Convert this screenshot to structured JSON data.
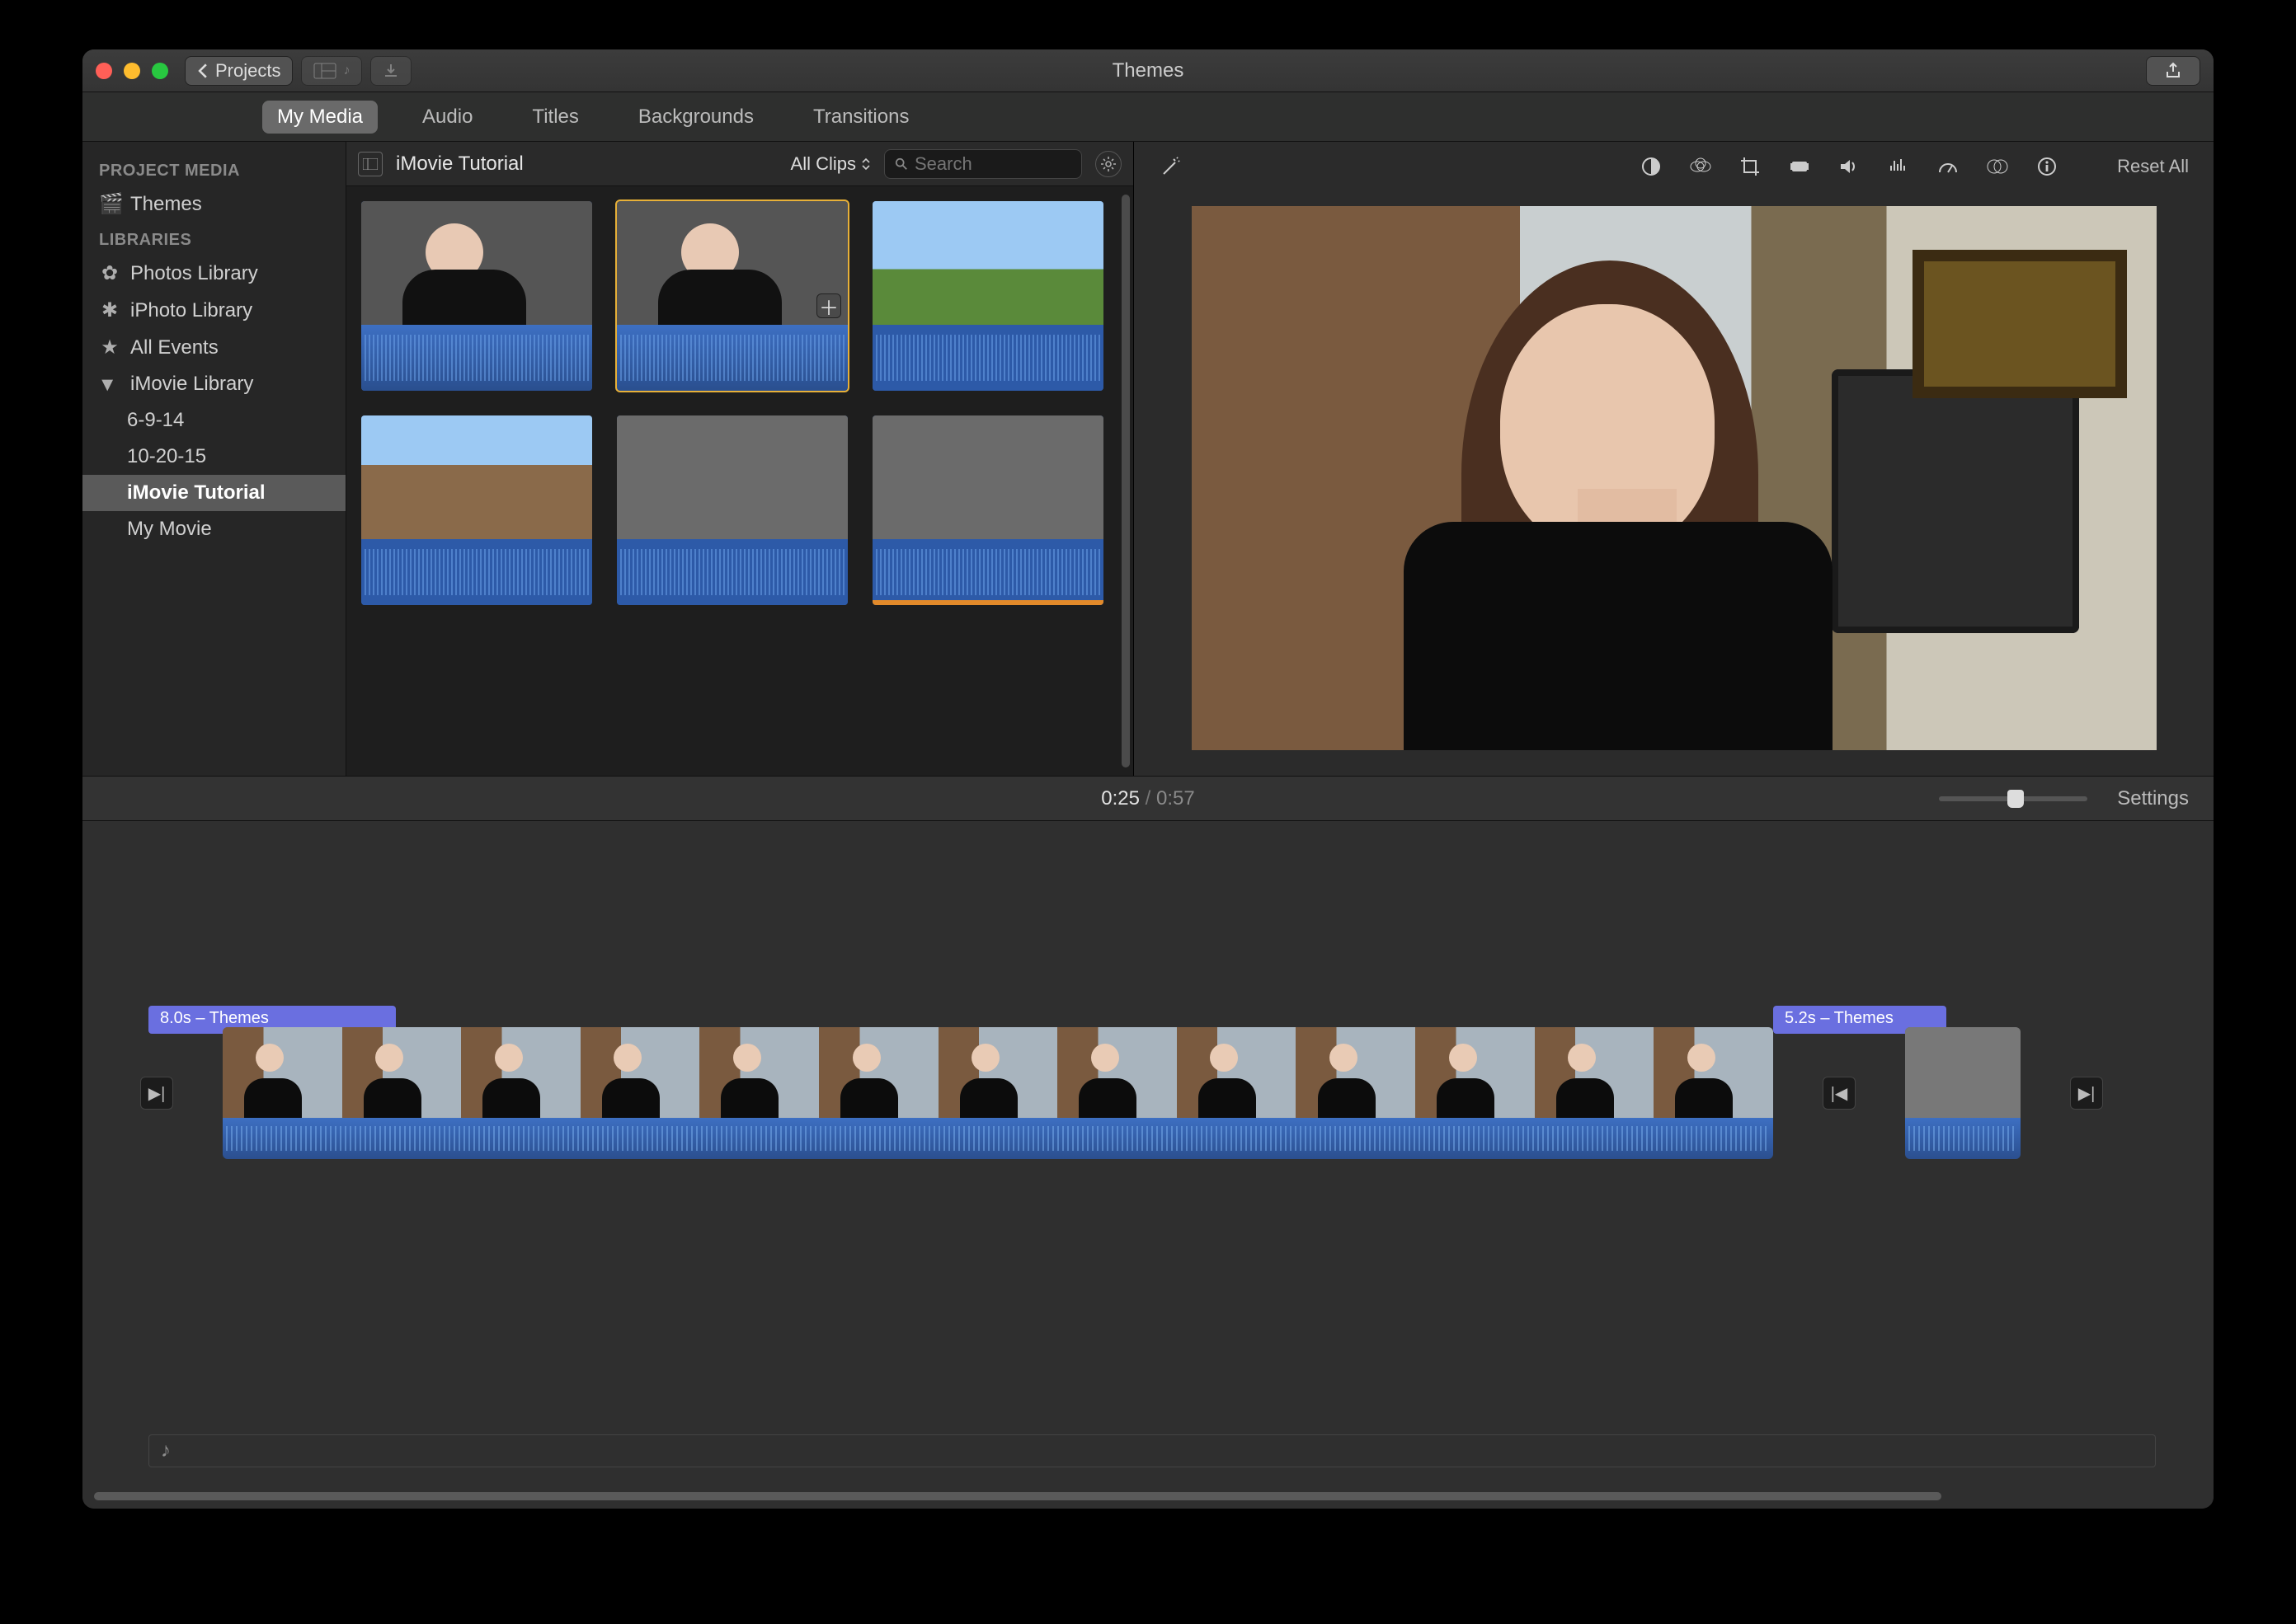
{
  "window": {
    "title": "Themes"
  },
  "toolbar": {
    "back_label": "Projects",
    "view_label": "View",
    "import_label": "Import",
    "share_label": "Share"
  },
  "tabs": {
    "items": [
      "My Media",
      "Audio",
      "Titles",
      "Backgrounds",
      "Transitions"
    ],
    "active": 0
  },
  "sidebar": {
    "header1": "PROJECT MEDIA",
    "themes": "Themes",
    "header2": "LIBRARIES",
    "photos": "Photos Library",
    "iphoto": "iPhoto Library",
    "allevents": "All Events",
    "ilib": "iMovie Library",
    "ilib_children": [
      "6-9-14",
      "10-20-15",
      "iMovie Tutorial",
      "My Movie"
    ],
    "selected": "iMovie Tutorial"
  },
  "browser": {
    "title": "iMovie Tutorial",
    "filter": "All Clips",
    "search_placeholder": "Search"
  },
  "preview": {
    "reset": "Reset All",
    "tool_names": [
      "magic-wand-icon",
      "color-balance-icon",
      "color-correction-icon",
      "crop-icon",
      "stabilize-icon",
      "volume-icon",
      "noise-reduction-icon",
      "speed-icon",
      "clip-filter-icon",
      "info-icon"
    ]
  },
  "status": {
    "current": "0:25",
    "total": "0:57",
    "settings": "Settings"
  },
  "timeline": {
    "label1": "8.0s – Themes",
    "label2": "5.2s – Themes"
  }
}
